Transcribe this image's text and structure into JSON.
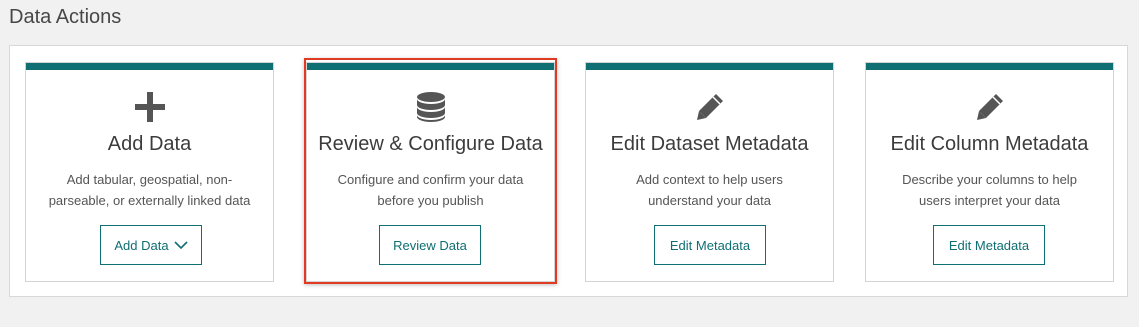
{
  "section": {
    "title": "Data Actions"
  },
  "cards": [
    {
      "title": "Add Data",
      "description": "Add tabular, geospatial, non-parseable, or externally linked data",
      "button_label": "Add Data",
      "icon": "plus-icon"
    },
    {
      "title": "Review & Configure Data",
      "description": "Configure and confirm your data before you publish",
      "button_label": "Review Data",
      "icon": "database-icon",
      "highlighted": true
    },
    {
      "title": "Edit Dataset Metadata",
      "description": "Add context to help users understand your data",
      "button_label": "Edit Metadata",
      "icon": "pencil-icon"
    },
    {
      "title": "Edit Column Metadata",
      "description": "Describe your columns to help users interpret your data",
      "button_label": "Edit Metadata",
      "icon": "pencil-icon"
    }
  ],
  "colors": {
    "accent": "#0f6f72",
    "highlight_border": "#e13a22",
    "icon": "#555555"
  }
}
